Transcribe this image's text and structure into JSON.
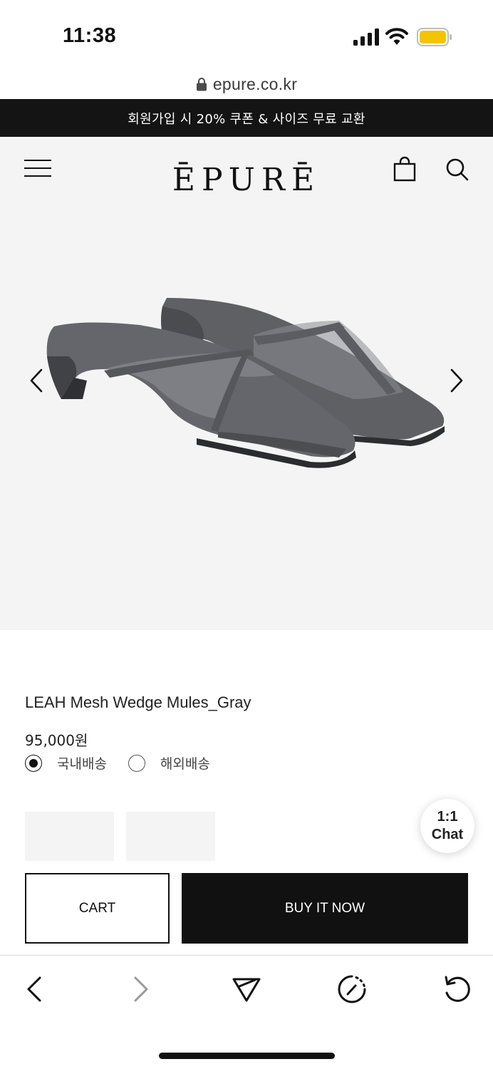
{
  "status_bar": {
    "time": "11:38",
    "battery_color": "#f5c400"
  },
  "browser": {
    "url": "epure.co.kr"
  },
  "announcement": {
    "text": "회원가입 시 20% 쿠폰 & 사이즈 무료 교환"
  },
  "header": {
    "logo": "ĒPURĒ"
  },
  "product": {
    "name": "LEAH Mesh Wedge Mules_Gray",
    "price": "95,000원",
    "shipping_options": [
      {
        "label": "국내배송",
        "selected": true
      },
      {
        "label": "해외배송",
        "selected": false
      }
    ]
  },
  "chat": {
    "line1": "1:1",
    "line2": "Chat"
  },
  "actions": {
    "cart_label": "CART",
    "buy_label": "BUY IT NOW"
  },
  "colors": {
    "dark": "#111111",
    "hero_bg": "#f4f4f4",
    "announcement_bg": "#141414"
  }
}
